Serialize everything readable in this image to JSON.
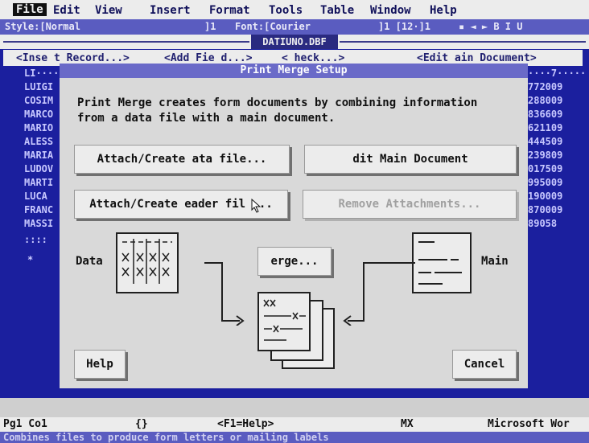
{
  "menu": {
    "file": "File",
    "edit": "Edit",
    "view": "View",
    "insert": "Insert",
    "format": "Format",
    "tools": "Tools",
    "table": "Table",
    "window": "Window",
    "help": "Help"
  },
  "ruler": {
    "style": "Style:[Normal",
    "pt1": "]1",
    "font": "Font:[Courier",
    "size": "]1 [12·]1",
    "fmt": "▪ ◄ ► B I U"
  },
  "file_name": "DATIUNO.DBF",
  "field_bar": {
    "insert_record": "<Inse t Record...>",
    "add_field": "<Add Fie d...>",
    "check": "< heck...>",
    "edit_main": "<Edit ain Document>"
  },
  "doc_left": {
    "header": "LI····",
    "rows": [
      "LUIGI",
      "COSIM",
      "MARCO",
      "MARIO",
      "ALESS",
      "MARIA",
      "LUDOV",
      "MARTI",
      "LUCA",
      "FRANC",
      "MASSI",
      "::::"
    ],
    "marker": "*"
  },
  "doc_right": {
    "header": "····7·····",
    "rows": [
      "772009",
      "288009",
      "836609",
      "621109",
      "444509",
      "239809",
      "017509",
      "995009",
      "190009",
      "870009",
      "89058"
    ]
  },
  "dialog": {
    "title": "Print Merge Setup",
    "description": "Print Merge creates form documents by combining information\nfrom a data file with a main document.",
    "btn_attach_data": "Attach/Create ata file...",
    "btn_edit_main": "dit Main Document",
    "btn_attach_header": "Attach/Create eader fil ...",
    "btn_remove": "Remove Attachments...",
    "data_label": "Data",
    "main_label": "Main",
    "btn_merge": "erge...",
    "btn_help": "Help",
    "btn_cancel": "Cancel"
  },
  "status": {
    "pos": "Pg1 Co1",
    "brace": "{}",
    "f1": "<F1=Help>",
    "mx": "MX",
    "app": "Microsoft Wor"
  },
  "help_line": "Combines files to produce form letters or mailing labels",
  "colors": {
    "desktop_blue": "#1b1f9e",
    "dialog_grey": "#d9d9d9",
    "title_bar": "#6a6ac8",
    "status_purple": "#5a5cc0"
  }
}
